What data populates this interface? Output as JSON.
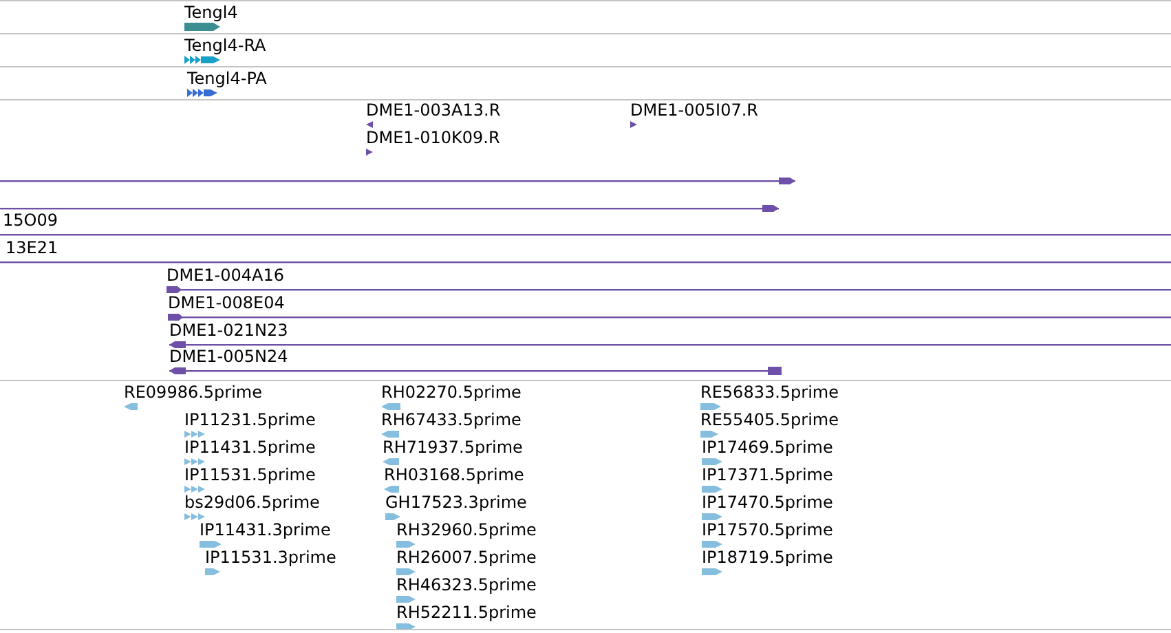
{
  "tracks": [
    {
      "color": "#3d8e93",
      "features": [
        {
          "kind": "gene",
          "label": "Tengl4",
          "reverse": false
        }
      ]
    },
    {
      "color": "#18a0c6",
      "features": [
        {
          "kind": "transcript",
          "label": "Tengl4-RA",
          "reverse": false
        }
      ]
    },
    {
      "color": "#386ed4",
      "features": [
        {
          "kind": "transcript",
          "label": "Tengl4-PA",
          "reverse": false
        }
      ]
    },
    {
      "color": "#6e50a8",
      "features": [
        {
          "kind": "clone-end",
          "label": "DME1-003A13.R",
          "reverse": true
        },
        {
          "kind": "clone-end",
          "label": "DME1-010K09.R",
          "reverse": false
        },
        {
          "kind": "clone-end",
          "label": "DME1-005I07.R",
          "reverse": false
        },
        {
          "kind": "clone",
          "reverse": false
        },
        {
          "kind": "clone",
          "reverse": false
        },
        {
          "kind": "clone",
          "label": "15O09"
        },
        {
          "kind": "clone",
          "label": "13E21"
        },
        {
          "kind": "clone",
          "label": "DME1-004A16",
          "reverse": false
        },
        {
          "kind": "clone",
          "label": "DME1-008E04",
          "reverse": false
        },
        {
          "kind": "clone",
          "label": "DME1-021N23",
          "reverse": true
        },
        {
          "kind": "clone",
          "label": "DME1-005N24",
          "reverse": true
        }
      ]
    },
    {
      "color": "#86bee0",
      "features": [
        {
          "kind": "read",
          "label": "RE09986.5prime",
          "reverse": true
        },
        {
          "kind": "spliced-read",
          "label": "IP11231.5prime",
          "reverse": false
        },
        {
          "kind": "spliced-read",
          "label": "IP11431.5prime",
          "reverse": false
        },
        {
          "kind": "spliced-read",
          "label": "IP11531.5prime",
          "reverse": false
        },
        {
          "kind": "spliced-read",
          "label": "bs29d06.5prime",
          "reverse": false
        },
        {
          "kind": "read",
          "label": "IP11431.3prime",
          "reverse": false
        },
        {
          "kind": "read",
          "label": "IP11531.3prime",
          "reverse": false
        },
        {
          "kind": "read",
          "label": "RH02270.5prime",
          "reverse": true
        },
        {
          "kind": "read",
          "label": "RH67433.5prime",
          "reverse": true
        },
        {
          "kind": "read",
          "label": "RH71937.5prime",
          "reverse": true
        },
        {
          "kind": "read",
          "label": "RH03168.5prime",
          "reverse": true
        },
        {
          "kind": "read",
          "label": "GH17523.3prime",
          "reverse": false
        },
        {
          "kind": "read",
          "label": "RH32960.5prime",
          "reverse": false
        },
        {
          "kind": "read",
          "label": "RH26007.5prime",
          "reverse": false
        },
        {
          "kind": "read",
          "label": "RH46323.5prime",
          "reverse": false
        },
        {
          "kind": "read",
          "label": "RH52211.5prime",
          "reverse": false
        },
        {
          "kind": "read",
          "label": "RE56833.5prime",
          "reverse": false
        },
        {
          "kind": "read",
          "label": "RE55405.5prime",
          "reverse": false
        },
        {
          "kind": "read",
          "label": "IP17469.5prime",
          "reverse": false
        },
        {
          "kind": "read",
          "label": "IP17371.5prime",
          "reverse": false
        },
        {
          "kind": "read",
          "label": "IP17470.5prime",
          "reverse": false
        },
        {
          "kind": "read",
          "label": "IP17570.5prime",
          "reverse": false
        },
        {
          "kind": "read",
          "label": "IP18719.5prime",
          "reverse": false
        }
      ]
    }
  ]
}
